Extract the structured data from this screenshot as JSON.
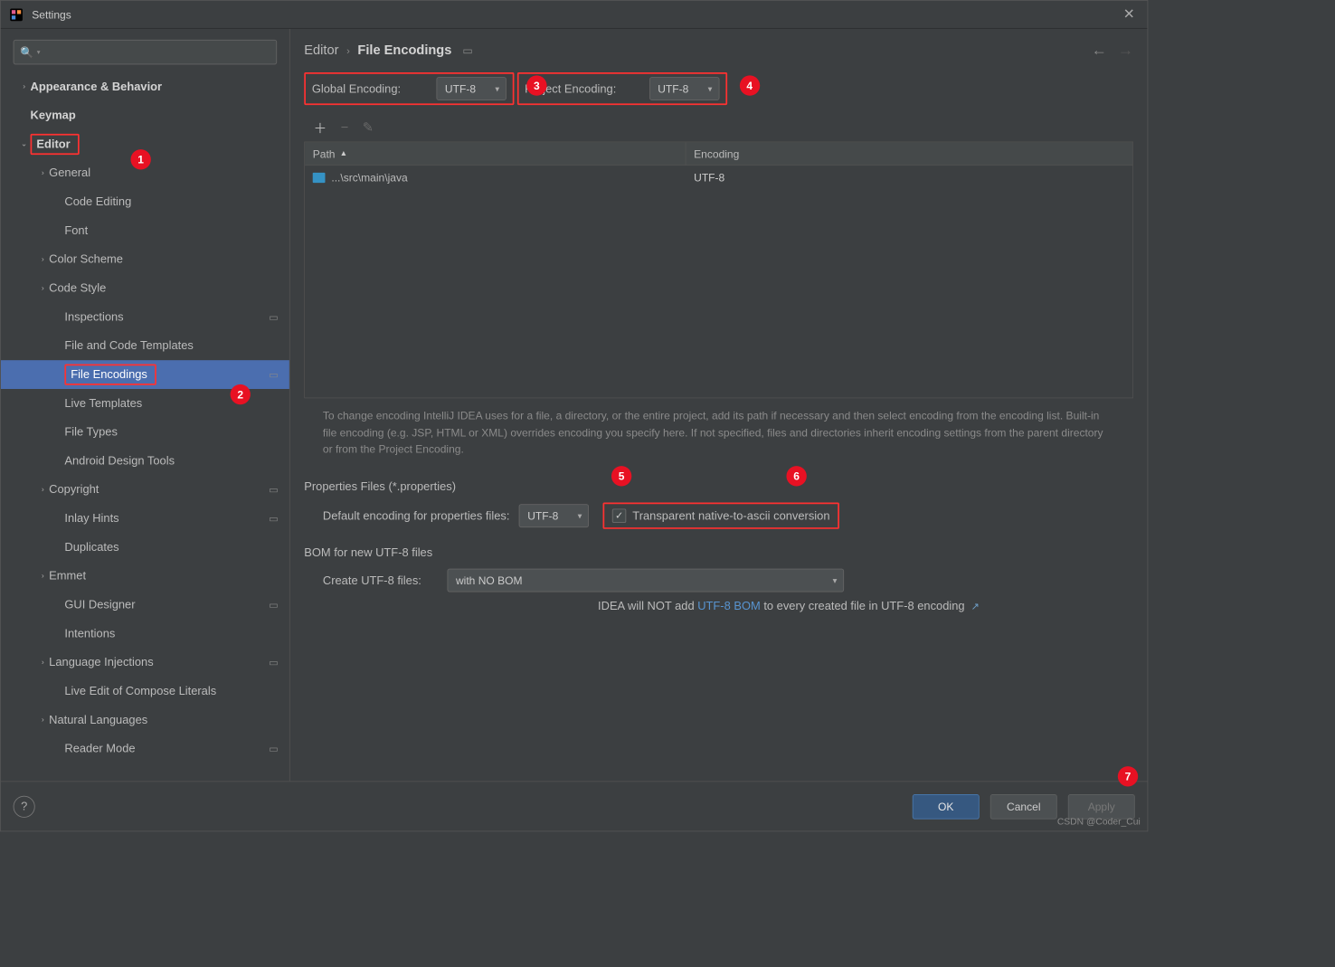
{
  "window": {
    "title": "Settings"
  },
  "search": {
    "placeholder": ""
  },
  "sidebar": {
    "items": [
      {
        "label": "Appearance & Behavior",
        "bold": true,
        "level": 1,
        "chev": "›",
        "hasProject": false
      },
      {
        "label": "Keymap",
        "bold": true,
        "level": 1,
        "chev": "",
        "hasProject": false
      },
      {
        "label": "Editor",
        "bold": true,
        "level": 1,
        "chev": "⌄",
        "hasProject": false,
        "highlight": true
      },
      {
        "label": "General",
        "bold": false,
        "level": 2,
        "chev": "›",
        "hasProject": false
      },
      {
        "label": "Code Editing",
        "bold": false,
        "level": 3,
        "chev": "",
        "hasProject": false
      },
      {
        "label": "Font",
        "bold": false,
        "level": 3,
        "chev": "",
        "hasProject": false
      },
      {
        "label": "Color Scheme",
        "bold": false,
        "level": 2,
        "chev": "›",
        "hasProject": false
      },
      {
        "label": "Code Style",
        "bold": false,
        "level": 2,
        "chev": "›",
        "hasProject": false
      },
      {
        "label": "Inspections",
        "bold": false,
        "level": 3,
        "chev": "",
        "hasProject": true
      },
      {
        "label": "File and Code Templates",
        "bold": false,
        "level": 3,
        "chev": "",
        "hasProject": false
      },
      {
        "label": "File Encodings",
        "bold": false,
        "level": 3,
        "chev": "",
        "hasProject": true,
        "selected": true,
        "highlight": true
      },
      {
        "label": "Live Templates",
        "bold": false,
        "level": 3,
        "chev": "",
        "hasProject": false
      },
      {
        "label": "File Types",
        "bold": false,
        "level": 3,
        "chev": "",
        "hasProject": false
      },
      {
        "label": "Android Design Tools",
        "bold": false,
        "level": 3,
        "chev": "",
        "hasProject": false
      },
      {
        "label": "Copyright",
        "bold": false,
        "level": 2,
        "chev": "›",
        "hasProject": true
      },
      {
        "label": "Inlay Hints",
        "bold": false,
        "level": 3,
        "chev": "",
        "hasProject": true
      },
      {
        "label": "Duplicates",
        "bold": false,
        "level": 3,
        "chev": "",
        "hasProject": false
      },
      {
        "label": "Emmet",
        "bold": false,
        "level": 2,
        "chev": "›",
        "hasProject": false
      },
      {
        "label": "GUI Designer",
        "bold": false,
        "level": 3,
        "chev": "",
        "hasProject": true
      },
      {
        "label": "Intentions",
        "bold": false,
        "level": 3,
        "chev": "",
        "hasProject": false
      },
      {
        "label": "Language Injections",
        "bold": false,
        "level": 2,
        "chev": "›",
        "hasProject": true
      },
      {
        "label": "Live Edit of Compose Literals",
        "bold": false,
        "level": 3,
        "chev": "",
        "hasProject": false
      },
      {
        "label": "Natural Languages",
        "bold": false,
        "level": 2,
        "chev": "›",
        "hasProject": false
      },
      {
        "label": "Reader Mode",
        "bold": false,
        "level": 3,
        "chev": "",
        "hasProject": true
      }
    ]
  },
  "breadcrumb": {
    "root": "Editor",
    "leaf": "File Encodings"
  },
  "fields": {
    "global_label": "Global Encoding:",
    "global_value": "UTF-8",
    "project_label": "Project Encoding:",
    "project_value": "UTF-8"
  },
  "table": {
    "col_path": "Path",
    "col_encoding": "Encoding",
    "rows": [
      {
        "path": "...\\src\\main\\java",
        "encoding": "UTF-8"
      }
    ]
  },
  "help_text": "To change encoding IntelliJ IDEA uses for a file, a directory, or the entire project, add its path if necessary and then select encoding from the encoding list. Built-in file encoding (e.g. JSP, HTML or XML) overrides encoding you specify here. If not specified, files and directories inherit encoding settings from the parent directory or from the Project Encoding.",
  "properties": {
    "section": "Properties Files (*.properties)",
    "default_label": "Default encoding for properties files:",
    "default_value": "UTF-8",
    "checkbox_label": "Transparent native-to-ascii conversion",
    "checked": true
  },
  "bom": {
    "section": "BOM for new UTF-8 files",
    "create_label": "Create UTF-8 files:",
    "create_value": "with NO BOM",
    "hint_prefix": "IDEA will NOT add ",
    "hint_link": "UTF-8 BOM",
    "hint_suffix": " to every created file in UTF-8 encoding"
  },
  "buttons": {
    "ok": "OK",
    "cancel": "Cancel",
    "apply": "Apply"
  },
  "badges": {
    "b1": "1",
    "b2": "2",
    "b3": "3",
    "b4": "4",
    "b5": "5",
    "b6": "6",
    "b7": "7"
  },
  "watermark": "CSDN @Coder_Cui"
}
